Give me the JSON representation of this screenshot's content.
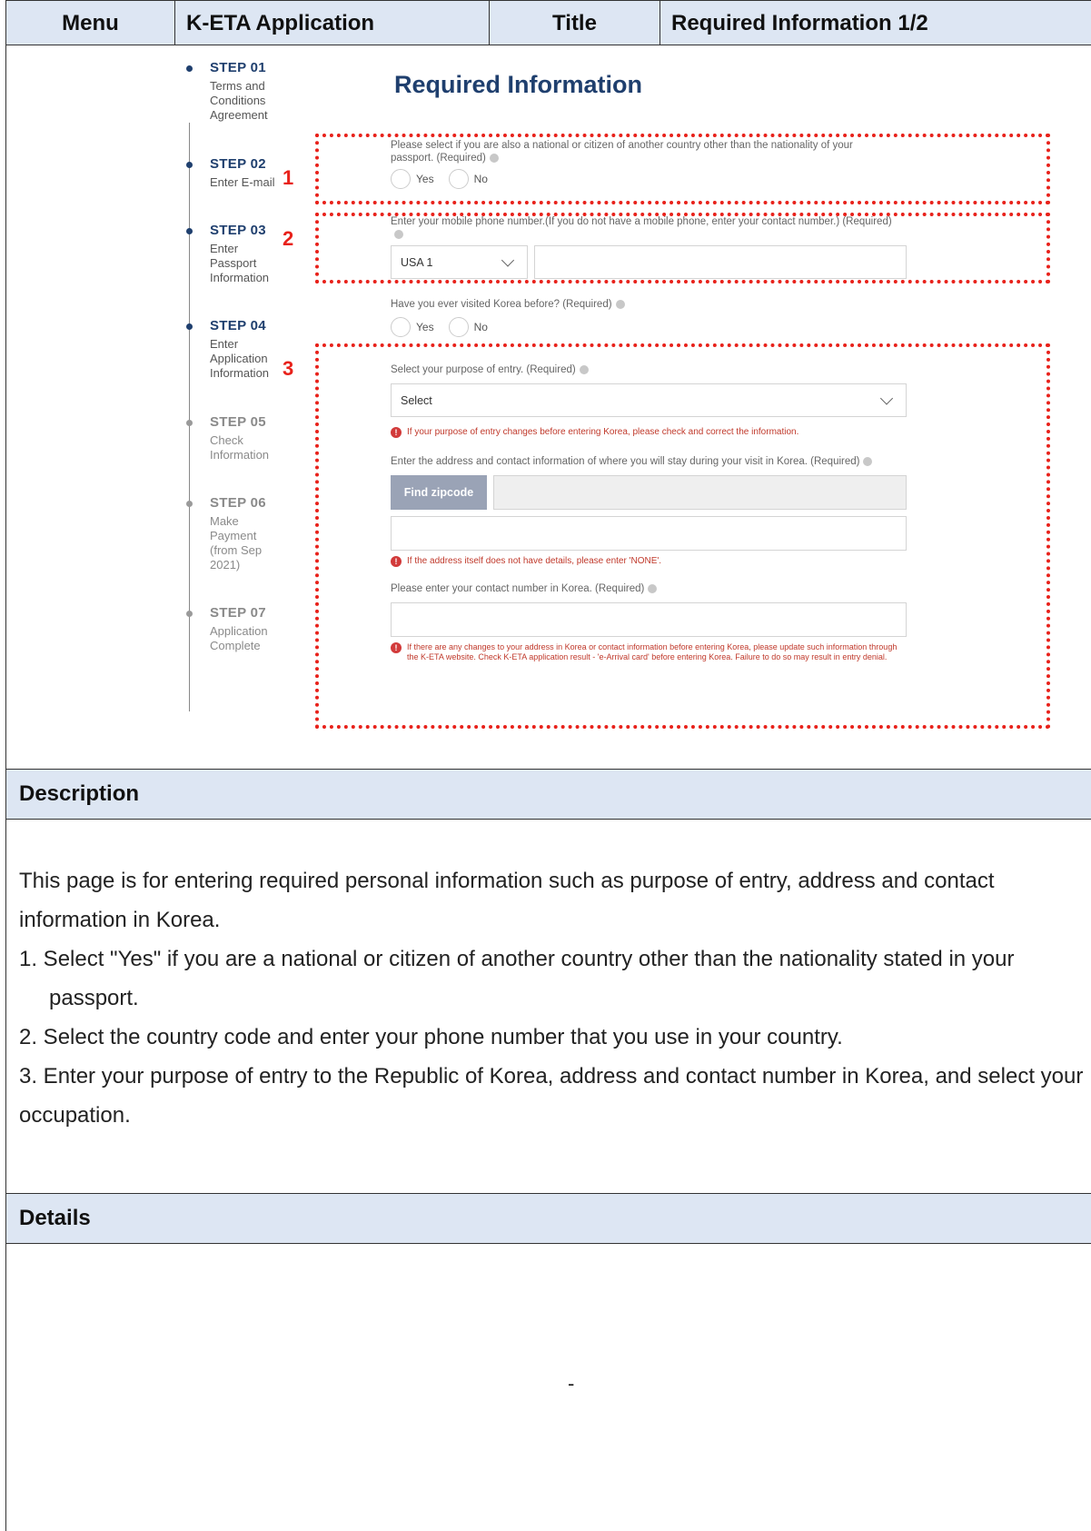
{
  "header": {
    "menu_label": "Menu",
    "menu_value": "K-ETA Application",
    "title_label": "Title",
    "title_value": "Required Information 1/2"
  },
  "stepper": [
    {
      "num": "STEP 01",
      "text": [
        "Terms and",
        "Conditions",
        "Agreement"
      ],
      "active": true
    },
    {
      "num": "STEP 02",
      "text": [
        "Enter E-mail"
      ],
      "active": true
    },
    {
      "num": "STEP 03",
      "text": [
        "Enter",
        "Passport",
        "Information"
      ],
      "active": true
    },
    {
      "num": "STEP 04",
      "text": [
        "Enter",
        "Application",
        "Information"
      ],
      "active": true
    },
    {
      "num": "STEP 05",
      "text": [
        "Check",
        "Information"
      ],
      "active": false
    },
    {
      "num": "STEP 06",
      "text": [
        "Make",
        "Payment",
        "(from Sep",
        "2021)"
      ],
      "active": false
    },
    {
      "num": "STEP 07",
      "text": [
        "Application",
        "Complete"
      ],
      "active": false
    }
  ],
  "annotations": [
    "1",
    "2",
    "3"
  ],
  "form": {
    "title": "Required Information",
    "dual_nationality_question": "Please select if you are also a national or citizen of another country other than the nationality of your passport. (Required)",
    "yes": "Yes",
    "no": "No",
    "phone_question": "Enter your mobile phone number.(If you do not have a mobile phone, enter your contact number.) (Required)",
    "country_code": "USA 1",
    "phone_number": "",
    "visited_question": "Have you ever visited Korea before? (Required)",
    "purpose_label": "Select your purpose of entry. (Required)",
    "purpose_value": "Select",
    "purpose_warning": "If your purpose of entry changes before entering Korea, please check and correct the information.",
    "address_label": "Enter the address and contact information of where you will stay during your visit in Korea. (Required)",
    "find_zipcode": "Find zipcode",
    "address_warning": "If the address itself does not have details, please enter 'NONE'.",
    "contact_label": "Please enter your contact number in Korea. (Required)",
    "contact_warning": "If there are any changes to your address in Korea or contact information before entering Korea, please update such information through the K-ETA website. Check K-ETA application result - 'e-Arrival card' before entering Korea. Failure to do so may result in entry denial."
  },
  "description": {
    "heading": "Description",
    "intro": "This page is for entering required personal information such as purpose of entry, address and contact information in Korea.",
    "items": [
      "1. Select \"Yes\" if you are a national or citizen of another country other than the nationality stated in your passport.",
      "2. Select the country code and enter your phone number that you use in your country.",
      "3. Enter your purpose of entry to the Republic of Korea, address and contact number in Korea, and select your occupation."
    ]
  },
  "details": {
    "heading": "Details",
    "content": "-"
  },
  "colors": {
    "header_bg": "#dde6f3",
    "brand_navy": "#1f3f6e",
    "annotation_red": "#e8211a"
  }
}
